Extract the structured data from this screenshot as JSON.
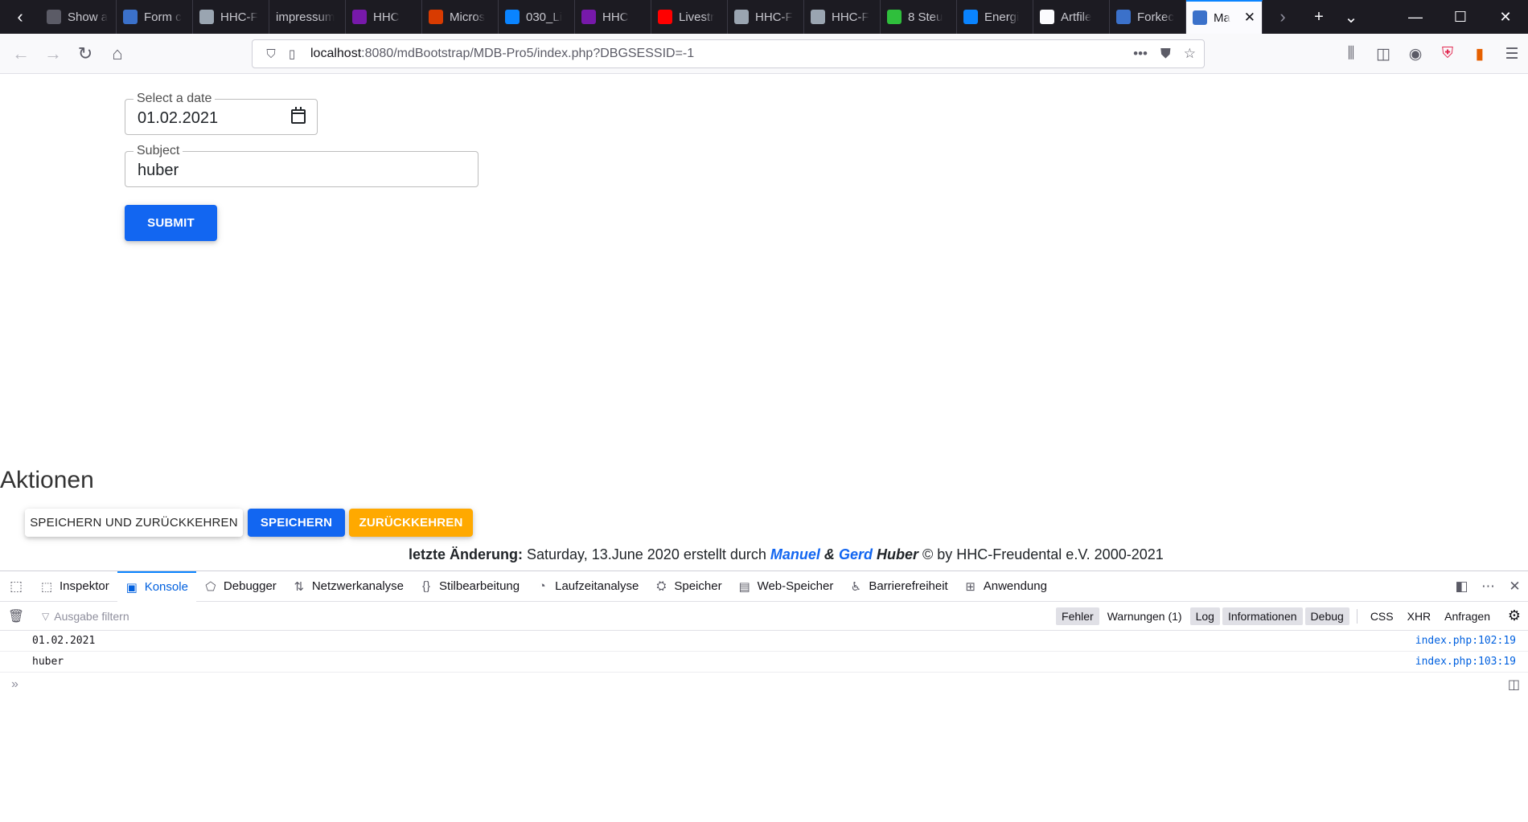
{
  "browser": {
    "tabs": [
      {
        "title": "Show a",
        "icon": "generic-page-icon",
        "color": "#5b5b66"
      },
      {
        "title": "Form c",
        "icon": "mdb-icon",
        "color": "#3b71ca"
      },
      {
        "title": "HHC-F",
        "icon": "hhc-icon",
        "color": "#9aa5b1"
      },
      {
        "title": "impressum",
        "icon": "none",
        "color": "#1c1b22"
      },
      {
        "title": "HHC",
        "icon": "onenote-icon",
        "color": "#7719aa"
      },
      {
        "title": "Micros",
        "icon": "office-icon",
        "color": "#d83b01"
      },
      {
        "title": "030_Li",
        "icon": "onedrive-icon",
        "color": "#0a84ff"
      },
      {
        "title": "HHC",
        "icon": "onenote-icon",
        "color": "#7719aa"
      },
      {
        "title": "Livestr",
        "icon": "youtube-icon",
        "color": "#ff0000"
      },
      {
        "title": "HHC-F",
        "icon": "hhc-icon",
        "color": "#9aa5b1"
      },
      {
        "title": "HHC-F",
        "icon": "hhc-icon",
        "color": "#9aa5b1"
      },
      {
        "title": "8 Steu",
        "icon": "green-ring-icon",
        "color": "#2fbf3c"
      },
      {
        "title": "Energi",
        "icon": "e-icon",
        "color": "#0a84ff"
      },
      {
        "title": "Artfile",
        "icon": "af-icon",
        "color": "#fbfbfe"
      },
      {
        "title": "Forkec",
        "icon": "mdb-icon",
        "color": "#3b71ca"
      },
      {
        "title": "Ma",
        "icon": "mdb-icon",
        "color": "#3b71ca",
        "active": true
      }
    ],
    "url_host": "localhost",
    "url_rest": ":8080/mdBootstrap/MDB-Pro5/index.php?DBGSESSID=-1"
  },
  "form": {
    "date_label": "Select a date",
    "date_value": "01.02.2021",
    "subject_label": "Subject",
    "subject_value": "huber",
    "submit_label": "Submit"
  },
  "actions": {
    "heading": "Aktionen",
    "save_return_label": "Speichern und Zurückkehren",
    "save_label": "Speichern",
    "return_label": "Zurückkehren"
  },
  "footer": {
    "prefix": "letzte Änderung:",
    "date_text": "Saturday, 13.June 2020 erstellt durch",
    "name1": "Manuel",
    "amp": "&",
    "name2": "Gerd",
    "surname": "Huber",
    "suffix": "© by HHC-Freudental e.V. 2000-2021"
  },
  "devtools": {
    "tabs": [
      {
        "label": "Inspektor",
        "icon": "inspector-icon"
      },
      {
        "label": "Konsole",
        "icon": "console-icon",
        "active": true
      },
      {
        "label": "Debugger",
        "icon": "debugger-icon"
      },
      {
        "label": "Netzwerkanalyse",
        "icon": "network-icon"
      },
      {
        "label": "Stilbearbeitung",
        "icon": "style-editor-icon"
      },
      {
        "label": "Laufzeitanalyse",
        "icon": "performance-icon"
      },
      {
        "label": "Speicher",
        "icon": "memory-icon"
      },
      {
        "label": "Web-Speicher",
        "icon": "storage-icon"
      },
      {
        "label": "Barrierefreiheit",
        "icon": "accessibility-icon"
      },
      {
        "label": "Anwendung",
        "icon": "application-icon"
      }
    ],
    "filter_placeholder": "Ausgabe filtern",
    "levels": [
      {
        "label": "Fehler",
        "on": true
      },
      {
        "label": "Warnungen (1)",
        "on": false
      },
      {
        "label": "Log",
        "on": true
      },
      {
        "label": "Informationen",
        "on": true
      },
      {
        "label": "Debug",
        "on": true
      }
    ],
    "extra_filters": [
      "CSS",
      "XHR",
      "Anfragen"
    ],
    "log": [
      {
        "message": "01.02.2021",
        "source": "index.php:102:19"
      },
      {
        "message": "huber",
        "source": "index.php:103:19"
      }
    ]
  }
}
